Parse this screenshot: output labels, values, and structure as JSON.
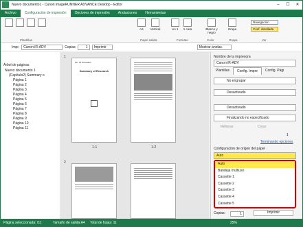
{
  "window": {
    "title": "Nuevo documento1 - Canon imageRUNNER ADVANCE Desktop - Editor",
    "minimize": "–",
    "maximize": "☐",
    "close": "✕"
  },
  "ribbon_tabs": [
    "Archivo",
    "Configuración de impresión",
    "Opciones de impresión",
    "Anotaciones",
    "Herramientas"
  ],
  "ribbon": {
    "groups": [
      "Plantillas",
      "Papel salida",
      "Formato",
      "Color",
      "Grapa",
      "Ver"
    ],
    "buttons": {
      "size": "A4",
      "orientation": "Vertical",
      "pages_per_sheet": "en 1",
      "duplex": "1 cara",
      "color": "Blanco y negro",
      "staple": "Grapa",
      "navigation": "Navegación",
      "detailed": "Conf. detallada"
    }
  },
  "toolbar": {
    "printer_label": "Impr.",
    "printer": "Canon iR-ADV",
    "copies_label": "Copias",
    "copies": "1",
    "print": "Imprimir",
    "show_annotations": "Mostrar anotac."
  },
  "left_panel": {
    "title": "Árbol de páginas",
    "root": "Nuevo documento 1",
    "chapter": "(Capítulo2) Summary o",
    "pages": [
      "Página 1",
      "Página 2",
      "Página 3",
      "Página 4",
      "Página 5",
      "Página 6",
      "Página 7",
      "Página 8",
      "Página 9",
      "Página 10",
      "Página 11"
    ]
  },
  "preview": {
    "chapter_nums": [
      "1",
      "2"
    ],
    "page_labels": [
      "1-1",
      "1-2"
    ],
    "page1_title": "Summary of Research",
    "page1_header": "Pin. ID Innovation"
  },
  "right_panel": {
    "printer_label": "Nombre de la impresora",
    "printer": "Canon iR-ADV",
    "tabs": [
      "Plantillas",
      "Config. Impre",
      "Config. Pági"
    ],
    "binding": "No engrapar",
    "sel1": "Desactivado",
    "sel2": "Desactivado",
    "finishing": "Finalizando no especificado",
    "cb1": "Rellenar",
    "cb2": "Crear",
    "value": "1",
    "detail_link": "Terminando opciones",
    "source_label": "Configuración de origen del papel",
    "source_value": "Auto",
    "source_options": [
      "Auto",
      "Bandeja multiuso",
      "Cassette 1",
      "Cassette 2",
      "Cassette 3",
      "Cassette 4",
      "Cassette 5"
    ],
    "bottom_copies_label": "Copias:",
    "bottom_copies": "1",
    "bottom_print": "Imprimir"
  },
  "status": {
    "selected": "Página seleccionada: /11",
    "size": "Tamaño de salida:A4",
    "total": "Total de hojas: 11",
    "zoom": "25%"
  },
  "colors": {
    "accent": "#1e7a4a",
    "highlight": "#ffe94d",
    "callout": "#d40000"
  }
}
